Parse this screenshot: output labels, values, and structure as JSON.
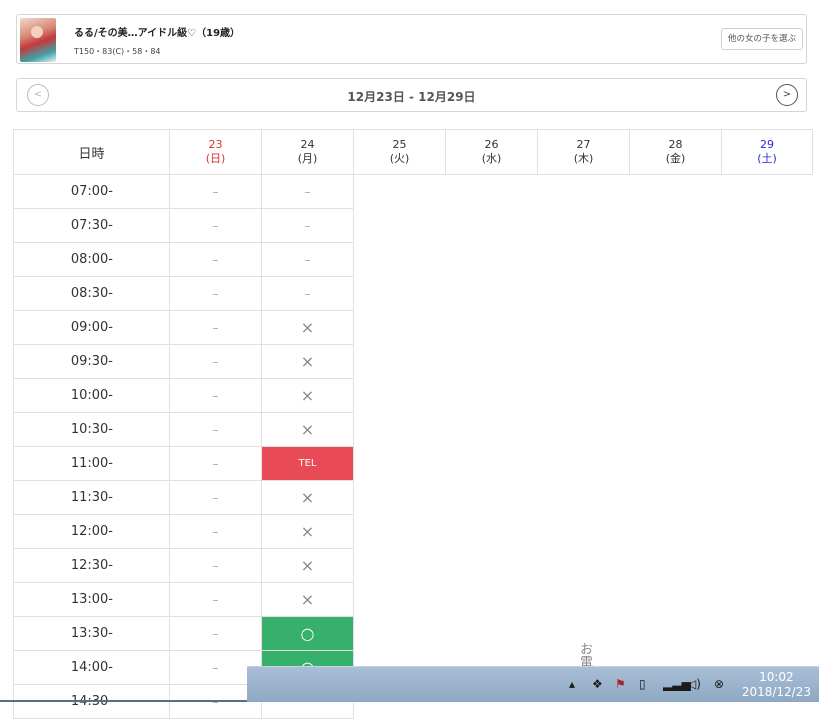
{
  "profile": {
    "name": "るる/その美…アイドル級♡（19歳）",
    "specs": "T150・83(C)・58・84",
    "choose_label": "他の女の子を選ぶ"
  },
  "week_nav": {
    "prev_label": "<",
    "next_label": ">",
    "title": "12月23日 - 12月29日"
  },
  "schedule": {
    "header_label": "日時",
    "days": [
      {
        "date": "23",
        "weekday": "(日)"
      },
      {
        "date": "24",
        "weekday": "(月)"
      },
      {
        "date": "25",
        "weekday": "(火)"
      },
      {
        "date": "26",
        "weekday": "(水)"
      },
      {
        "date": "27",
        "weekday": "(木)"
      },
      {
        "date": "28",
        "weekday": "(金)"
      },
      {
        "date": "29",
        "weekday": "(土)"
      }
    ],
    "rows": [
      {
        "time": "07:00-",
        "d23": "–",
        "d24": "–"
      },
      {
        "time": "07:30-",
        "d23": "–",
        "d24": "–"
      },
      {
        "time": "08:00-",
        "d23": "–",
        "d24": "–"
      },
      {
        "time": "08:30-",
        "d23": "–",
        "d24": "–"
      },
      {
        "time": "09:00-",
        "d23": "–",
        "d24": "×"
      },
      {
        "time": "09:30-",
        "d23": "–",
        "d24": "×"
      },
      {
        "time": "10:00-",
        "d23": "–",
        "d24": "×"
      },
      {
        "time": "10:30-",
        "d23": "–",
        "d24": "×"
      },
      {
        "time": "11:00-",
        "d23": "–",
        "d24": "TEL"
      },
      {
        "time": "11:30-",
        "d23": "–",
        "d24": "×"
      },
      {
        "time": "12:00-",
        "d23": "–",
        "d24": "×"
      },
      {
        "time": "12:30-",
        "d23": "–",
        "d24": "×"
      },
      {
        "time": "13:00-",
        "d23": "–",
        "d24": "×"
      },
      {
        "time": "13:30-",
        "d23": "–",
        "d24": "○"
      },
      {
        "time": "14:00-",
        "d23": "–",
        "d24": "○"
      },
      {
        "time": "14:30-",
        "d23": "–",
        "d24": ""
      }
    ],
    "side_note": "お電"
  },
  "colors": {
    "sunday": "#e03030",
    "saturday": "#2a2ad0",
    "tel": "#e84b55",
    "available": "#36b06a"
  },
  "taskbar": {
    "time": "10:02",
    "date": "2018/12/23",
    "tray_icons": [
      "up-arrow-icon",
      "dropbox-icon",
      "flag-icon",
      "power-icon",
      "signal-icon",
      "volume-icon",
      "close-circle-icon"
    ]
  }
}
